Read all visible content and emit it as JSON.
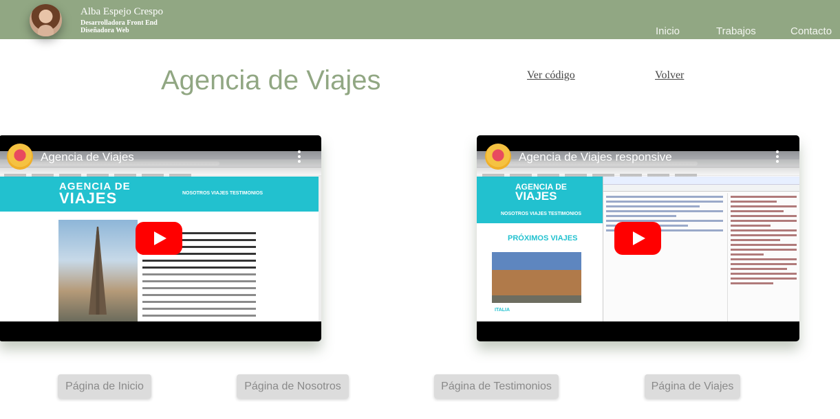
{
  "header": {
    "name": "Alba Espejo Crespo",
    "role_1": "Desarrolladora Front End",
    "role_2": "Diseñadora Web",
    "nav": [
      "Inicio",
      "Trabajos",
      "Contacto"
    ],
    "background_color": "#91a783"
  },
  "main": {
    "title": "Agencia de Viajes",
    "link_code": "Ver código",
    "link_back": "Volver",
    "accent_color": "#91a783"
  },
  "videos": [
    {
      "title": "Agencia de Viajes",
      "site_logo_line1": "AGENCIA DE",
      "site_logo_line2": "VIAJES",
      "site_nav": "NOSOTROS    VIAJES    TESTIMONIOS",
      "play_icon": "youtube-play-icon"
    },
    {
      "title": "Agencia de Viajes responsive",
      "site_logo_line1": "AGENCIA DE",
      "site_logo_line2": "VIAJES",
      "site_nav": "NOSOTROS    VIAJES    TESTIMONIOS",
      "section_heading": "PRÓXIMOS VIAJES",
      "country": "ITALIA",
      "play_icon": "youtube-play-icon"
    }
  ],
  "buttons": [
    "Página de Inicio",
    "Página de Nosotros",
    "Página de Testimonios",
    "Página de Viajes"
  ]
}
